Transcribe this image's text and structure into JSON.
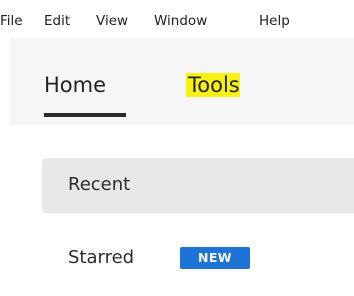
{
  "menu": {
    "file": "File",
    "edit": "Edit",
    "view": "View",
    "window": "Window",
    "help": "Help"
  },
  "tabs": {
    "home": "Home",
    "tools": "Tools"
  },
  "nav": {
    "recent": "Recent",
    "starred": "Starred",
    "new_badge": "NEW"
  },
  "colors": {
    "highlight": "#f8f214",
    "badge": "#1d73d6",
    "selected_row": "#e8e8e8",
    "tab_underline": "#2a2a2a"
  }
}
